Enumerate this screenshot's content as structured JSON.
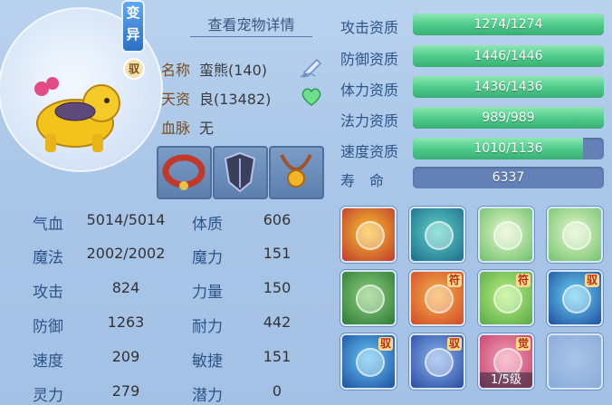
{
  "header": {
    "mutation_badge": "变异",
    "bind_badge": "驭",
    "details_link": "查看宠物详情"
  },
  "info": {
    "name_label": "名称",
    "name_value": "蛮熊(140)",
    "aptitude_label": "天资",
    "aptitude_value": "良(13482)",
    "bloodline_label": "血脉",
    "bloodline_value": "无"
  },
  "icons": {
    "edit": "pencil-icon",
    "favorite": "heart-icon"
  },
  "equipment": [
    "collar-icon",
    "armor-icon",
    "necklace-icon"
  ],
  "stats": [
    {
      "label": "气血",
      "value": "5014/5014",
      "label2": "体质",
      "value2": "606"
    },
    {
      "label": "魔法",
      "value": "2002/2002",
      "label2": "魔力",
      "value2": "151"
    },
    {
      "label": "攻击",
      "value": "824",
      "label2": "力量",
      "value2": "150"
    },
    {
      "label": "防御",
      "value": "1263",
      "label2": "耐力",
      "value2": "442"
    },
    {
      "label": "速度",
      "value": "209",
      "label2": "敏捷",
      "value2": "151"
    },
    {
      "label": "灵力",
      "value": "279",
      "label2": "潜力",
      "value2": "0"
    }
  ],
  "resistances": [
    {
      "label": "攻击资质",
      "text": "1274/1274",
      "fill": 1.0
    },
    {
      "label": "防御资质",
      "text": "1446/1446",
      "fill": 1.0
    },
    {
      "label": "体力资质",
      "text": "1436/1436",
      "fill": 1.0
    },
    {
      "label": "法力资质",
      "text": "989/989",
      "fill": 1.0
    },
    {
      "label": "速度资质",
      "text": "1010/1136",
      "fill": 0.889
    }
  ],
  "lifespan": {
    "label": "寿　命",
    "value": "6337"
  },
  "skills": [
    {
      "name": "charge-skill-icon",
      "tag": "",
      "colors": [
        "#f8c531",
        "#c0392b"
      ]
    },
    {
      "name": "shadow-figure-skill-icon",
      "tag": "",
      "colors": [
        "#5fd3c8",
        "#1d6c8a"
      ]
    },
    {
      "name": "fire-palm-skill-icon",
      "tag": "",
      "colors": [
        "#e9f7cf",
        "#6cc06a"
      ]
    },
    {
      "name": "water-palm-skill-icon",
      "tag": "",
      "colors": [
        "#e5f7cf",
        "#74c36c"
      ]
    },
    {
      "name": "turtle-skill-icon",
      "tag": "",
      "colors": [
        "#8fd07a",
        "#2c7a3a"
      ]
    },
    {
      "name": "hourglass-skill-icon",
      "tag": "符",
      "colors": [
        "#f7b24d",
        "#d14a27"
      ]
    },
    {
      "name": "heart-skill-icon",
      "tag": "符",
      "colors": [
        "#b9f27f",
        "#5aa84a"
      ]
    },
    {
      "name": "spirit-orb-skill-icon",
      "tag": "驭",
      "colors": [
        "#6bd6f5",
        "#1f4ea0"
      ]
    },
    {
      "name": "shield-skill-icon",
      "tag": "驭",
      "colors": [
        "#69c8f5",
        "#1c4fa2"
      ]
    },
    {
      "name": "blade-skill-icon",
      "tag": "驭",
      "colors": [
        "#8bb5f0",
        "#2a4ba0"
      ]
    },
    {
      "name": "awaken-skill-icon",
      "tag": "觉",
      "caption": "1/5级",
      "colors": [
        "#f4a2b6",
        "#c33f6b"
      ]
    },
    {
      "name": "empty-skill-slot",
      "tag": "",
      "colors": [
        "#a9c4e8",
        "#8aabd9"
      ]
    }
  ]
}
